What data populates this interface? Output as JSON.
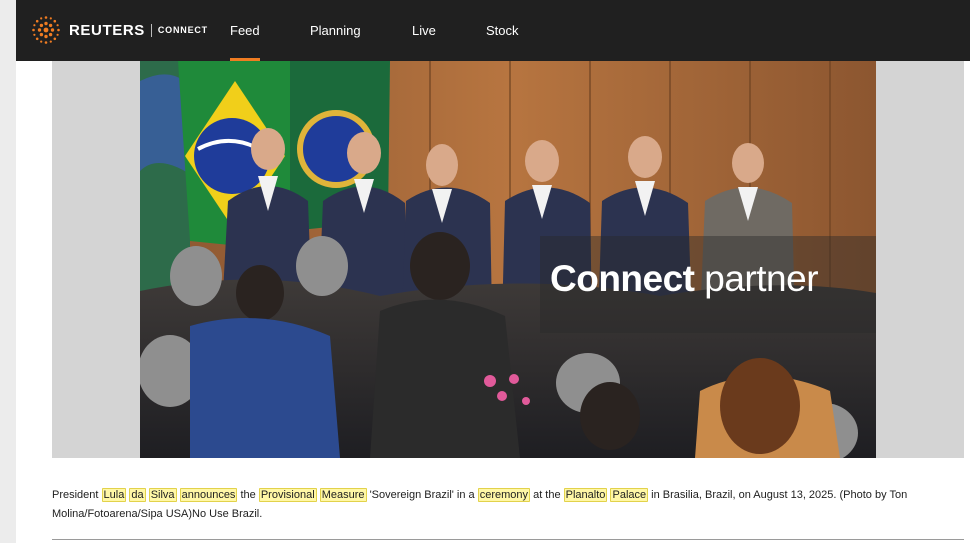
{
  "header": {
    "brand": "REUTERS",
    "brand_sub": "CONNECT",
    "nav": [
      {
        "label": "Feed",
        "active": true
      },
      {
        "label": "Planning",
        "active": false
      },
      {
        "label": "Live",
        "active": false
      },
      {
        "label": "Stock",
        "active": false
      }
    ]
  },
  "photo": {
    "overlay_bold": "Connect",
    "overlay_light": "partner"
  },
  "caption": {
    "segments": [
      {
        "text": "President ",
        "highlight": false
      },
      {
        "text": "Lula",
        "highlight": true
      },
      {
        "text": " ",
        "highlight": false
      },
      {
        "text": "da",
        "highlight": true
      },
      {
        "text": " ",
        "highlight": false
      },
      {
        "text": "Silva",
        "highlight": true
      },
      {
        "text": " ",
        "highlight": false
      },
      {
        "text": "announces",
        "highlight": true
      },
      {
        "text": " the ",
        "highlight": false
      },
      {
        "text": "Provisional",
        "highlight": true
      },
      {
        "text": " ",
        "highlight": false
      },
      {
        "text": "Measure",
        "highlight": true
      },
      {
        "text": " 'Sovereign Brazil' in a ",
        "highlight": false
      },
      {
        "text": "ceremony",
        "highlight": true
      },
      {
        "text": " at the ",
        "highlight": false
      },
      {
        "text": "Planalto",
        "highlight": true
      },
      {
        "text": " ",
        "highlight": false
      },
      {
        "text": "Palace",
        "highlight": true
      },
      {
        "text": " in Brasilia, Brazil, on August 13, 2025. (Photo by Ton Molina/Fotoarena/Sipa USA)No Use Brazil.",
        "highlight": false
      }
    ]
  },
  "colors": {
    "topbar": "#202020",
    "accent": "#f07c22",
    "highlight_bg": "#fff7a6",
    "highlight_border": "#e2d24b"
  },
  "icons": {
    "logo": "reuters-dot-logo-icon"
  }
}
